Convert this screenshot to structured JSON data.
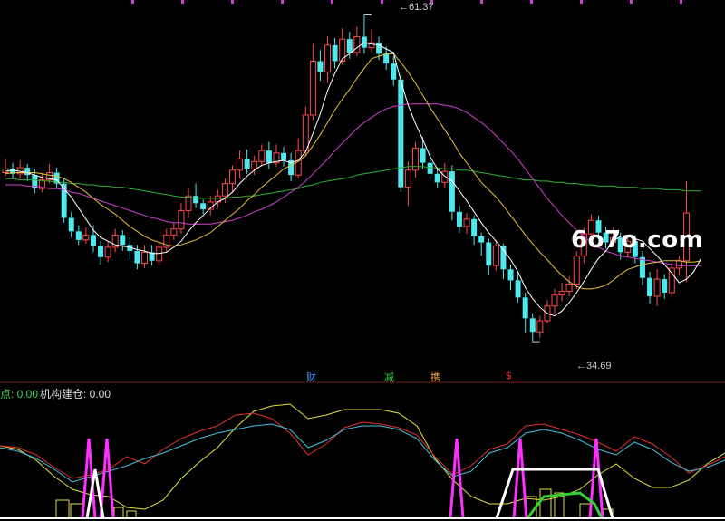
{
  "watermark": "6o7o.com",
  "price_high_label": "61.37",
  "price_low_label": "34.69",
  "markers": [
    {
      "text": "财",
      "color": "#4aa0ff"
    },
    {
      "text": "减",
      "color": "#3ad04a"
    },
    {
      "text": "携",
      "color": "#f0a040"
    },
    {
      "text": "$",
      "color": "#ff3030"
    }
  ],
  "indicator": {
    "label1": "点: 0.00",
    "label1_color": "#3ad04a",
    "label2": "机构建仓: 0.00",
    "label2_color": "#dcdcdc"
  },
  "colors": {
    "up": "#ff4a4a",
    "down": "#4ee8ee",
    "ma5": "#ffffff",
    "ma10": "#e6c23a",
    "ma30": "#d040d0",
    "ma60": "#30b030",
    "ind_red": "#e03030",
    "ind_cyan": "#40c0e0",
    "ind_yellow": "#e0e040",
    "ind_magenta": "#ff30ff",
    "ind_green": "#30d030"
  },
  "chart_data": {
    "type": "candlestick",
    "ylim": [
      33,
      62
    ],
    "high": 61.37,
    "low": 34.69,
    "candles": [
      [
        48.5,
        48.8,
        49.6,
        48.2
      ],
      [
        48.8,
        48.4,
        49.3,
        48.0
      ],
      [
        48.4,
        48.9,
        49.5,
        48.0
      ],
      [
        48.9,
        48.3,
        49.2,
        47.8
      ],
      [
        48.3,
        47.2,
        48.8,
        46.8
      ],
      [
        47.2,
        47.9,
        48.5,
        46.9
      ],
      [
        47.9,
        48.5,
        49.2,
        47.6
      ],
      [
        48.5,
        47.6,
        48.9,
        47.2
      ],
      [
        47.6,
        44.8,
        48.0,
        44.4
      ],
      [
        44.8,
        43.7,
        45.3,
        43.2
      ],
      [
        43.7,
        43.0,
        44.2,
        42.6
      ],
      [
        43.0,
        43.4,
        44.0,
        42.7
      ],
      [
        43.4,
        42.5,
        44.2,
        42.0
      ],
      [
        42.5,
        41.6,
        42.9,
        41.0
      ],
      [
        41.6,
        42.4,
        42.9,
        41.2
      ],
      [
        42.4,
        43.4,
        43.9,
        42.0
      ],
      [
        43.4,
        42.6,
        43.8,
        42.1
      ],
      [
        42.6,
        42.1,
        43.2,
        41.4
      ],
      [
        42.1,
        41.1,
        42.6,
        40.6
      ],
      [
        41.1,
        42.0,
        42.6,
        40.7
      ],
      [
        42.0,
        41.3,
        42.6,
        40.9
      ],
      [
        41.3,
        42.4,
        42.9,
        40.9
      ],
      [
        42.4,
        43.4,
        43.9,
        42.0
      ],
      [
        43.4,
        43.9,
        44.4,
        43.0
      ],
      [
        43.9,
        45.4,
        46.0,
        43.5
      ],
      [
        45.4,
        46.6,
        47.2,
        44.8
      ],
      [
        46.6,
        46.0,
        47.6,
        45.6
      ],
      [
        46.0,
        45.5,
        46.3,
        45.1
      ],
      [
        45.5,
        46.1,
        46.6,
        45.0
      ],
      [
        46.1,
        46.6,
        47.1,
        45.6
      ],
      [
        46.6,
        47.6,
        48.0,
        46.0
      ],
      [
        47.6,
        48.7,
        49.1,
        46.9
      ],
      [
        48.7,
        49.6,
        50.3,
        48.0
      ],
      [
        49.6,
        48.8,
        50.4,
        48.4
      ],
      [
        48.8,
        49.4,
        49.9,
        48.3
      ],
      [
        49.4,
        50.3,
        50.8,
        49.0
      ],
      [
        50.3,
        49.3,
        51.0,
        48.8
      ],
      [
        49.3,
        50.1,
        50.8,
        49.0
      ],
      [
        50.1,
        49.5,
        50.6,
        49.0
      ],
      [
        49.5,
        48.3,
        50.1,
        47.8
      ],
      [
        48.3,
        50.3,
        51.3,
        48.0
      ],
      [
        50.3,
        53.2,
        53.9,
        49.8
      ],
      [
        53.2,
        57.6,
        59.0,
        52.8
      ],
      [
        57.6,
        56.7,
        58.5,
        56.0
      ],
      [
        56.7,
        58.9,
        59.6,
        55.8
      ],
      [
        58.9,
        57.6,
        59.5,
        57.0
      ],
      [
        57.6,
        59.4,
        60.3,
        57.3
      ],
      [
        59.4,
        58.3,
        60.0,
        57.8
      ],
      [
        58.3,
        59.6,
        60.4,
        58.0
      ],
      [
        59.6,
        58.7,
        61.37,
        58.2
      ],
      [
        58.7,
        59.1,
        60.2,
        58.3
      ],
      [
        59.1,
        58.2,
        59.6,
        57.7
      ],
      [
        58.2,
        57.4,
        58.8,
        56.9
      ],
      [
        57.4,
        56.1,
        58.0,
        55.6
      ],
      [
        56.1,
        47.3,
        56.5,
        46.9
      ],
      [
        47.3,
        48.7,
        49.4,
        45.8
      ],
      [
        48.7,
        50.5,
        51.0,
        48.1
      ],
      [
        50.5,
        49.3,
        51.4,
        48.8
      ],
      [
        49.3,
        48.4,
        50.1,
        48.0
      ],
      [
        48.4,
        47.7,
        48.9,
        47.2
      ],
      [
        47.7,
        48.6,
        49.3,
        47.2
      ],
      [
        48.6,
        45.3,
        49.1,
        44.6
      ],
      [
        45.3,
        44.1,
        45.8,
        43.6
      ],
      [
        44.1,
        44.7,
        45.2,
        43.5
      ],
      [
        44.7,
        43.3,
        45.0,
        42.6
      ],
      [
        43.3,
        42.8,
        43.6,
        41.7
      ],
      [
        42.8,
        40.9,
        43.1,
        40.1
      ],
      [
        40.9,
        42.5,
        43.0,
        40.5
      ],
      [
        42.5,
        40.6,
        42.7,
        39.8
      ],
      [
        40.6,
        39.7,
        41.0,
        38.9
      ],
      [
        39.7,
        38.3,
        40.3,
        37.9
      ],
      [
        38.3,
        36.6,
        38.7,
        35.4
      ],
      [
        36.6,
        35.5,
        37.0,
        34.69
      ],
      [
        35.5,
        36.4,
        36.8,
        35.0
      ],
      [
        36.4,
        37.6,
        38.1,
        36.2
      ],
      [
        37.6,
        38.5,
        39.0,
        37.0
      ],
      [
        38.5,
        38.8,
        39.5,
        38.0
      ],
      [
        38.8,
        39.4,
        40.0,
        38.4
      ],
      [
        39.4,
        41.7,
        42.1,
        39.0
      ],
      [
        41.7,
        43.5,
        44.0,
        41.1
      ],
      [
        43.5,
        44.6,
        45.1,
        43.0
      ],
      [
        44.6,
        43.6,
        45.0,
        43.1
      ],
      [
        43.6,
        42.8,
        44.1,
        42.3
      ],
      [
        42.8,
        43.2,
        44.0,
        42.4
      ],
      [
        43.2,
        42.0,
        43.6,
        41.4
      ],
      [
        42.0,
        42.9,
        43.4,
        41.6
      ],
      [
        42.9,
        41.6,
        43.4,
        41.1
      ],
      [
        41.6,
        39.9,
        42.1,
        39.3
      ],
      [
        39.9,
        38.4,
        40.4,
        37.8
      ],
      [
        38.4,
        39.8,
        40.6,
        37.6
      ],
      [
        39.8,
        38.7,
        40.2,
        38.2
      ],
      [
        38.7,
        40.7,
        41.1,
        38.3
      ],
      [
        40.7,
        41.3,
        41.7,
        40.1
      ],
      [
        41.3,
        45.2,
        47.8,
        39.6
      ]
    ],
    "ma5": [
      48.6,
      48.7,
      48.6,
      48.5,
      48.3,
      48.1,
      48.0,
      47.9,
      47.2,
      46.5,
      45.6,
      44.7,
      43.8,
      43.2,
      42.9,
      42.6,
      42.5,
      42.4,
      42.2,
      42.1,
      41.9,
      41.9,
      42.0,
      42.4,
      42.9,
      43.7,
      44.4,
      45.0,
      45.6,
      46.1,
      46.4,
      46.9,
      47.6,
      48.2,
      48.7,
      49.1,
      49.3,
      49.4,
      49.5,
      49.3,
      49.5,
      50.2,
      51.7,
      53.3,
      55.2,
      56.6,
      57.8,
      58.2,
      58.7,
      59.1,
      59.0,
      58.9,
      58.6,
      58.3,
      56.0,
      54.0,
      52.5,
      51.2,
      49.8,
      48.8,
      48.2,
      47.8,
      47.0,
      46.2,
      45.3,
      44.4,
      43.6,
      42.9,
      42.2,
      41.4,
      40.4,
      39.1,
      38.2,
      37.5,
      37.0,
      36.8,
      37.2,
      37.9,
      38.7,
      39.6,
      40.6,
      41.5,
      42.1,
      42.9,
      43.3,
      43.4,
      43.1,
      42.9,
      42.3,
      41.7,
      41.0,
      40.3,
      39.5,
      39.8,
      40.4,
      41.5
    ],
    "ma10": [
      48.4,
      48.5,
      48.5,
      48.5,
      48.5,
      48.4,
      48.3,
      48.2,
      48.0,
      47.7,
      47.3,
      46.9,
      46.4,
      45.9,
      45.5,
      45.1,
      44.6,
      44.1,
      43.7,
      43.3,
      43.0,
      42.8,
      42.6,
      42.5,
      42.6,
      42.8,
      43.0,
      43.3,
      43.6,
      44.1,
      44.6,
      45.1,
      45.6,
      46.2,
      46.7,
      47.3,
      47.8,
      48.3,
      48.8,
      49.1,
      49.4,
      49.9,
      50.7,
      51.6,
      52.6,
      53.6,
      54.5,
      55.3,
      56.2,
      57.0,
      57.8,
      58.0,
      58.2,
      58.2,
      57.5,
      56.7,
      55.8,
      54.8,
      53.8,
      52.9,
      52.0,
      51.1,
      50.1,
      49.3,
      48.5,
      47.7,
      47.1,
      46.5,
      45.8,
      45.0,
      44.2,
      43.4,
      42.7,
      42.0,
      41.4,
      40.7,
      40.1,
      39.6,
      39.2,
      39.0,
      39.0,
      39.1,
      39.3,
      39.7,
      40.2,
      40.6,
      40.8,
      41.0,
      41.1,
      41.2,
      41.3,
      41.3,
      41.3,
      41.2,
      41.2,
      41.3
    ],
    "ma30": [
      47.5,
      47.5,
      47.5,
      47.4,
      47.4,
      47.3,
      47.2,
      47.2,
      47.1,
      46.9,
      46.8,
      46.6,
      46.4,
      46.2,
      46.0,
      45.8,
      45.6,
      45.4,
      45.2,
      45.0,
      44.8,
      44.7,
      44.5,
      44.4,
      44.4,
      44.3,
      44.3,
      44.3,
      44.3,
      44.4,
      44.5,
      44.6,
      44.8,
      45.0,
      45.3,
      45.5,
      45.8,
      46.1,
      46.5,
      46.9,
      47.3,
      47.8,
      48.4,
      49.0,
      49.6,
      50.3,
      50.9,
      51.5,
      52.1,
      52.6,
      53.0,
      53.4,
      53.7,
      53.9,
      54.0,
      54.1,
      54.1,
      54.1,
      54.1,
      54.1,
      54.0,
      53.9,
      53.7,
      53.4,
      53.0,
      52.6,
      52.1,
      51.5,
      50.9,
      50.3,
      49.6,
      48.8,
      48.0,
      47.2,
      46.4,
      45.7,
      45.0,
      44.4,
      43.8,
      43.3,
      42.8,
      42.4,
      42.1,
      41.9,
      41.7,
      41.6,
      41.5,
      41.4,
      41.3,
      41.2,
      41.1,
      41.0,
      40.9,
      40.9,
      40.9,
      40.9
    ],
    "ma60": [
      48.0,
      48.0,
      47.9,
      47.9,
      47.9,
      47.8,
      47.8,
      47.7,
      47.7,
      47.6,
      47.6,
      47.5,
      47.5,
      47.4,
      47.4,
      47.3,
      47.3,
      47.2,
      47.1,
      47.0,
      46.9,
      46.8,
      46.7,
      46.6,
      46.5,
      46.5,
      46.4,
      46.4,
      46.4,
      46.4,
      46.4,
      46.5,
      46.5,
      46.6,
      46.6,
      46.7,
      46.8,
      46.9,
      47.0,
      47.1,
      47.2,
      47.4,
      47.5,
      47.7,
      47.8,
      47.9,
      48.0,
      48.1,
      48.3,
      48.4,
      48.5,
      48.6,
      48.7,
      48.8,
      48.9,
      49.0,
      49.0,
      49.0,
      48.9,
      48.9,
      48.8,
      48.8,
      48.7,
      48.7,
      48.6,
      48.5,
      48.4,
      48.3,
      48.2,
      48.1,
      48.0,
      47.9,
      47.9,
      47.8,
      47.8,
      47.7,
      47.7,
      47.6,
      47.6,
      47.5,
      47.5,
      47.4,
      47.4,
      47.4,
      47.3,
      47.3,
      47.3,
      47.2,
      47.2,
      47.2,
      47.1,
      47.1,
      47.1,
      47.0,
      47.0,
      47.0
    ]
  }
}
